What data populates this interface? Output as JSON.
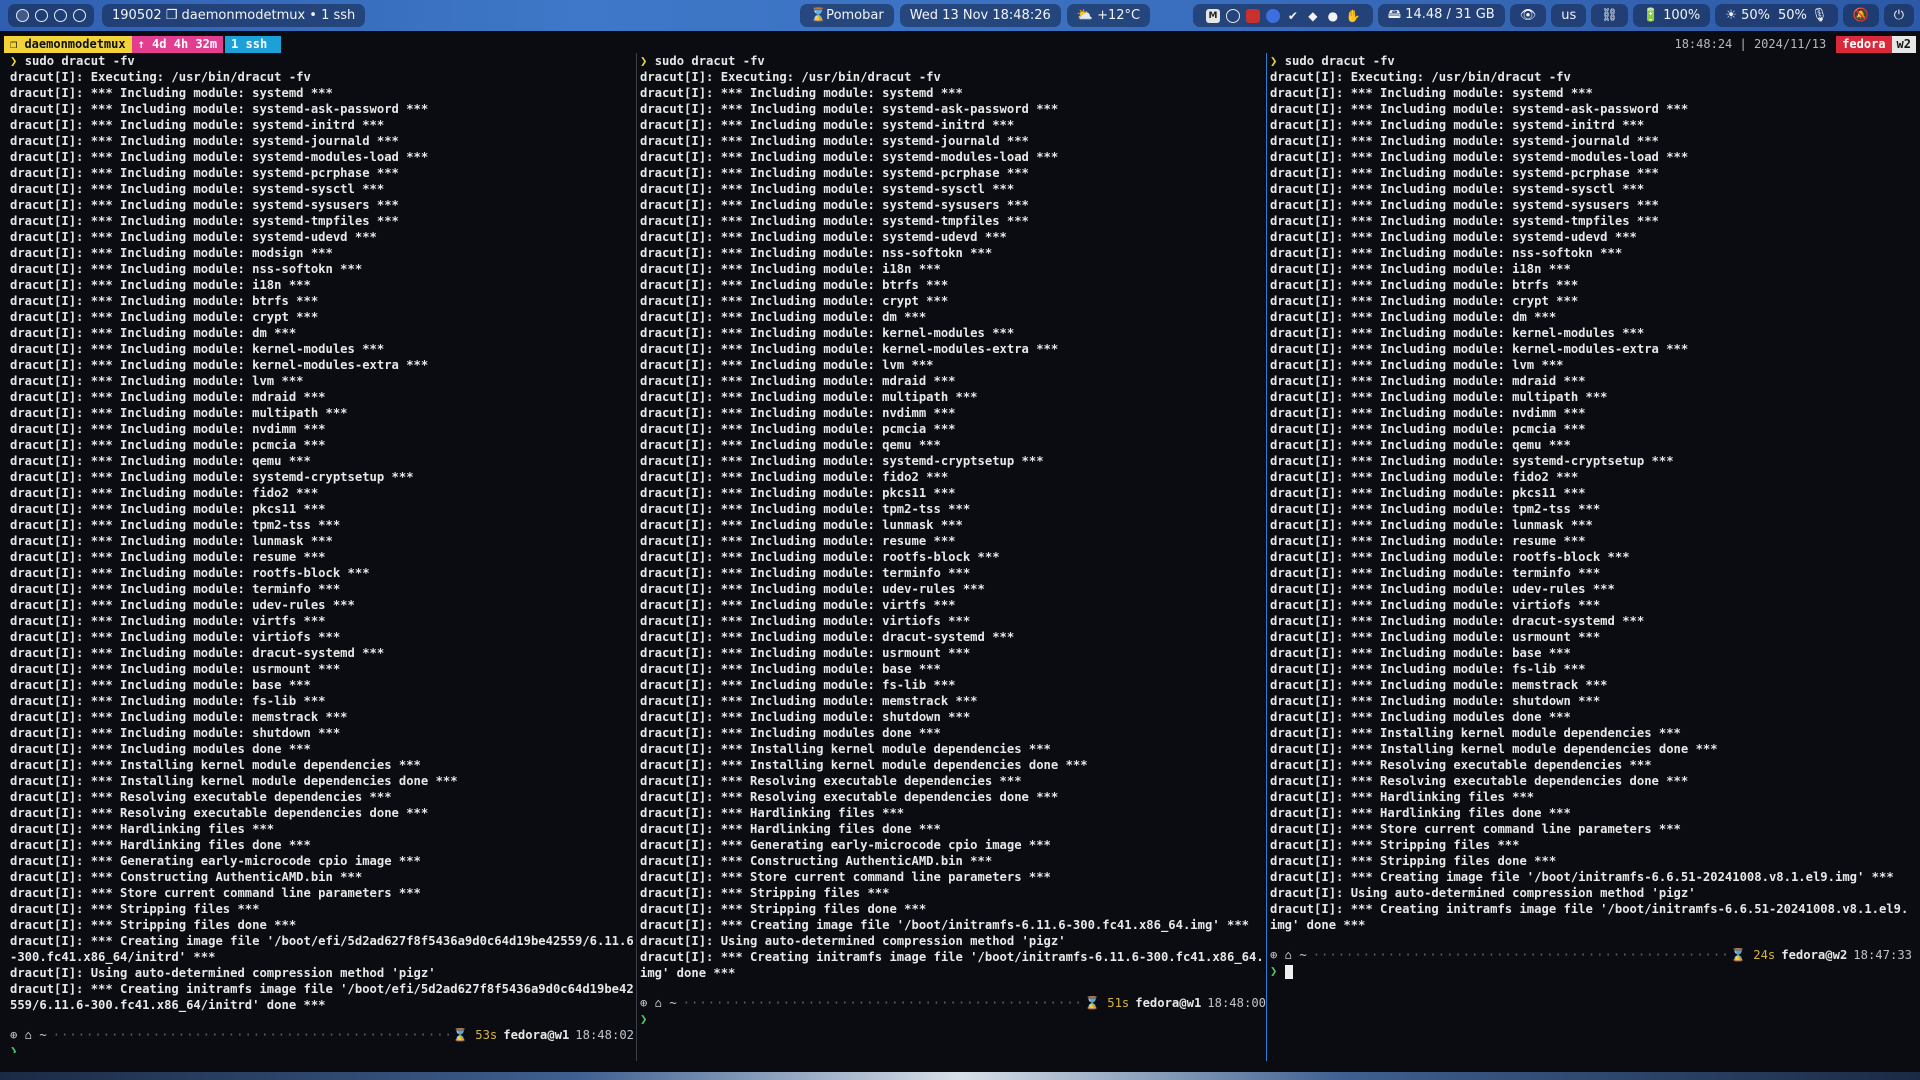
{
  "topbar": {
    "window_title": "190502 ❐ daemonmodetmux • 1 ssh",
    "timer": "⌛Pomobar",
    "datetime": "Wed 13 Nov  18:48:26",
    "weather": "⛅ +12°C",
    "memory": "🖴 14.48 / 31 GB",
    "keyboard_layout": "us",
    "battery": "100%",
    "brightness": "50%",
    "volume": "50%"
  },
  "tmux": {
    "session": "❐ daemonmodetmux",
    "uptime": "↑ 4d 4h 32m",
    "window": "1 ssh",
    "clock": "18:48:24 | 2024/11/13",
    "host": "fedora",
    "window_index": "w2"
  },
  "prompt": "❯",
  "command": "sudo dracut -fv",
  "executing": "dracut[I]: Executing: /usr/bin/dracut -fv",
  "modules": [
    "systemd",
    "systemd-ask-password",
    "systemd-initrd",
    "systemd-journald",
    "systemd-modules-load",
    "systemd-pcrphase",
    "systemd-sysctl",
    "systemd-sysusers",
    "systemd-tmpfiles",
    "systemd-udevd",
    "modsign",
    "nss-softokn",
    "i18n",
    "btrfs",
    "crypt",
    "dm",
    "kernel-modules",
    "kernel-modules-extra",
    "lvm",
    "mdraid",
    "multipath",
    "nvdimm",
    "pcmcia",
    "qemu",
    "systemd-cryptsetup",
    "fido2",
    "pkcs11",
    "tpm2-tss",
    "lunmask",
    "resume",
    "rootfs-block",
    "terminfo",
    "udev-rules",
    "virtfs",
    "virtiofs",
    "dracut-systemd",
    "usrmount",
    "base",
    "fs-lib",
    "memstrack",
    "shutdown"
  ],
  "pane1": {
    "tail": [
      "dracut[I]: *** Including modules done ***",
      "dracut[I]: *** Installing kernel module dependencies ***",
      "dracut[I]: *** Installing kernel module dependencies done ***",
      "dracut[I]: *** Resolving executable dependencies ***",
      "dracut[I]: *** Resolving executable dependencies done ***",
      "dracut[I]: *** Hardlinking files ***",
      "dracut[I]: *** Hardlinking files done ***",
      "dracut[I]: *** Generating early-microcode cpio image ***",
      "dracut[I]: *** Constructing AuthenticAMD.bin ***",
      "dracut[I]: *** Store current command line parameters ***",
      "dracut[I]: *** Stripping files ***",
      "dracut[I]: *** Stripping files done ***",
      "dracut[I]: *** Creating image file '/boot/efi/5d2ad627f8f5436a9d0c64d19be42559/6.11.6-300.fc41.x86_64/initrd' ***",
      "dracut[I]: Using auto-determined compression method 'pigz'",
      "dracut[I]: *** Creating initramfs image file '/boot/efi/5d2ad627f8f5436a9d0c64d19be42559/6.11.6-300.fc41.x86_64/initrd' done ***"
    ],
    "duration": "⌛ 53s",
    "host": "fedora@w1",
    "time": "18:48:02"
  },
  "pane2": {
    "tail": [
      "dracut[I]: *** Including modules done ***",
      "dracut[I]: *** Installing kernel module dependencies ***",
      "dracut[I]: *** Installing kernel module dependencies done ***",
      "dracut[I]: *** Resolving executable dependencies ***",
      "dracut[I]: *** Resolving executable dependencies done ***",
      "dracut[I]: *** Hardlinking files ***",
      "dracut[I]: *** Hardlinking files done ***",
      "dracut[I]: *** Generating early-microcode cpio image ***",
      "dracut[I]: *** Constructing AuthenticAMD.bin ***",
      "dracut[I]: *** Store current command line parameters ***",
      "dracut[I]: *** Stripping files ***",
      "dracut[I]: *** Stripping files done ***",
      "dracut[I]: *** Creating image file '/boot/initramfs-6.11.6-300.fc41.x86_64.img' ***",
      "dracut[I]: Using auto-determined compression method 'pigz'",
      "dracut[I]: *** Creating initramfs image file '/boot/initramfs-6.11.6-300.fc41.x86_64.img' done ***"
    ],
    "duration": "⌛ 51s",
    "host": "fedora@w1",
    "time": "18:48:00"
  },
  "pane3": {
    "tail": [
      "dracut[I]: *** Including modules done ***",
      "dracut[I]: *** Installing kernel module dependencies ***",
      "dracut[I]: *** Installing kernel module dependencies done ***",
      "dracut[I]: *** Resolving executable dependencies ***",
      "dracut[I]: *** Resolving executable dependencies done ***",
      "dracut[I]: *** Hardlinking files ***",
      "dracut[I]: *** Hardlinking files done ***",
      "dracut[I]: *** Store current command line parameters ***",
      "dracut[I]: *** Stripping files ***",
      "dracut[I]: *** Stripping files done ***",
      "dracut[I]: *** Creating image file '/boot/initramfs-6.6.51-20241008.v8.1.el9.img' ***",
      "dracut[I]: Using auto-determined compression method 'pigz'",
      "dracut[I]: *** Creating initramfs image file '/boot/initramfs-6.6.51-20241008.v8.1.el9.img' done ***"
    ],
    "duration": "⌛ 24s",
    "host": "fedora@w2",
    "time": "18:47:33"
  },
  "colors": {
    "session": "#f2d33a",
    "uptime": "#e23d8e",
    "window": "#1ba1d8",
    "host": "#d82a3a",
    "prompt": "#f0d23c"
  }
}
